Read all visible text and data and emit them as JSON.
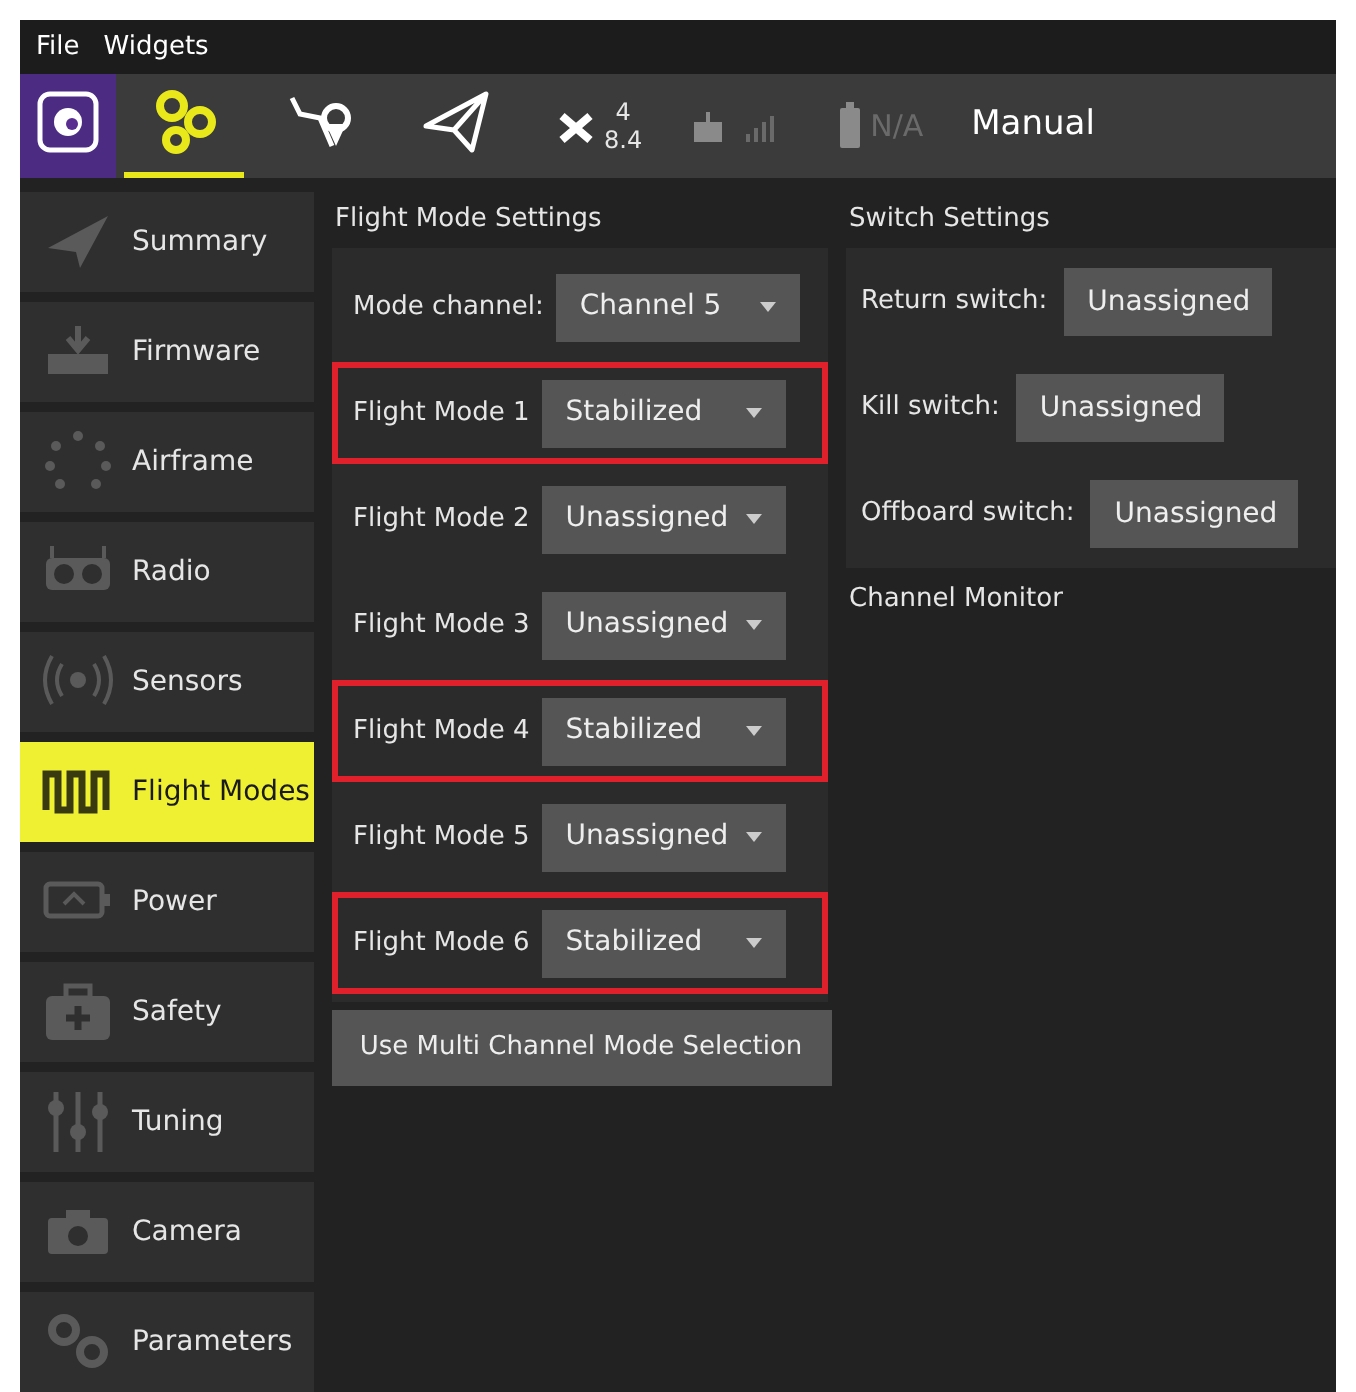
{
  "menu": [
    "File",
    "Widgets"
  ],
  "toolbar": {
    "tools": [
      {
        "kind": "logo",
        "selected": false
      },
      {
        "kind": "setup",
        "selected": true
      },
      {
        "kind": "plan",
        "selected": false
      },
      {
        "kind": "fly",
        "selected": false
      }
    ],
    "gps": {
      "count": "4",
      "hdop": "8.4"
    },
    "battery": "N/A",
    "flight_mode": "Manual"
  },
  "sidebar": {
    "items": [
      {
        "label": "Summary",
        "selected": false
      },
      {
        "label": "Firmware",
        "selected": false
      },
      {
        "label": "Airframe",
        "selected": false
      },
      {
        "label": "Radio",
        "selected": false
      },
      {
        "label": "Sensors",
        "selected": false
      },
      {
        "label": "Flight Modes",
        "selected": true
      },
      {
        "label": "Power",
        "selected": false
      },
      {
        "label": "Safety",
        "selected": false
      },
      {
        "label": "Tuning",
        "selected": false
      },
      {
        "label": "Camera",
        "selected": false
      },
      {
        "label": "Parameters",
        "selected": false
      }
    ]
  },
  "flight_mode_settings": {
    "title": "Flight Mode Settings",
    "rows": [
      {
        "label": "Mode channel:",
        "value": "Channel 5",
        "highlighted": false
      },
      {
        "label": "Flight Mode 1",
        "value": "Stabilized",
        "highlighted": true
      },
      {
        "label": "Flight Mode 2",
        "value": "Unassigned",
        "highlighted": false
      },
      {
        "label": "Flight Mode 3",
        "value": "Unassigned",
        "highlighted": false
      },
      {
        "label": "Flight Mode 4",
        "value": "Stabilized",
        "highlighted": true
      },
      {
        "label": "Flight Mode 5",
        "value": "Unassigned",
        "highlighted": false
      },
      {
        "label": "Flight Mode 6",
        "value": "Stabilized",
        "highlighted": true
      }
    ],
    "button": "Use Multi Channel Mode Selection"
  },
  "switch_settings": {
    "title": "Switch Settings",
    "rows": [
      {
        "label": "Return switch:",
        "value": "Unassigned"
      },
      {
        "label": "Kill switch:",
        "value": "Unassigned"
      },
      {
        "label": "Offboard switch:",
        "value": "Unassigned"
      }
    ]
  },
  "channel_monitor": {
    "title": "Channel Monitor"
  }
}
